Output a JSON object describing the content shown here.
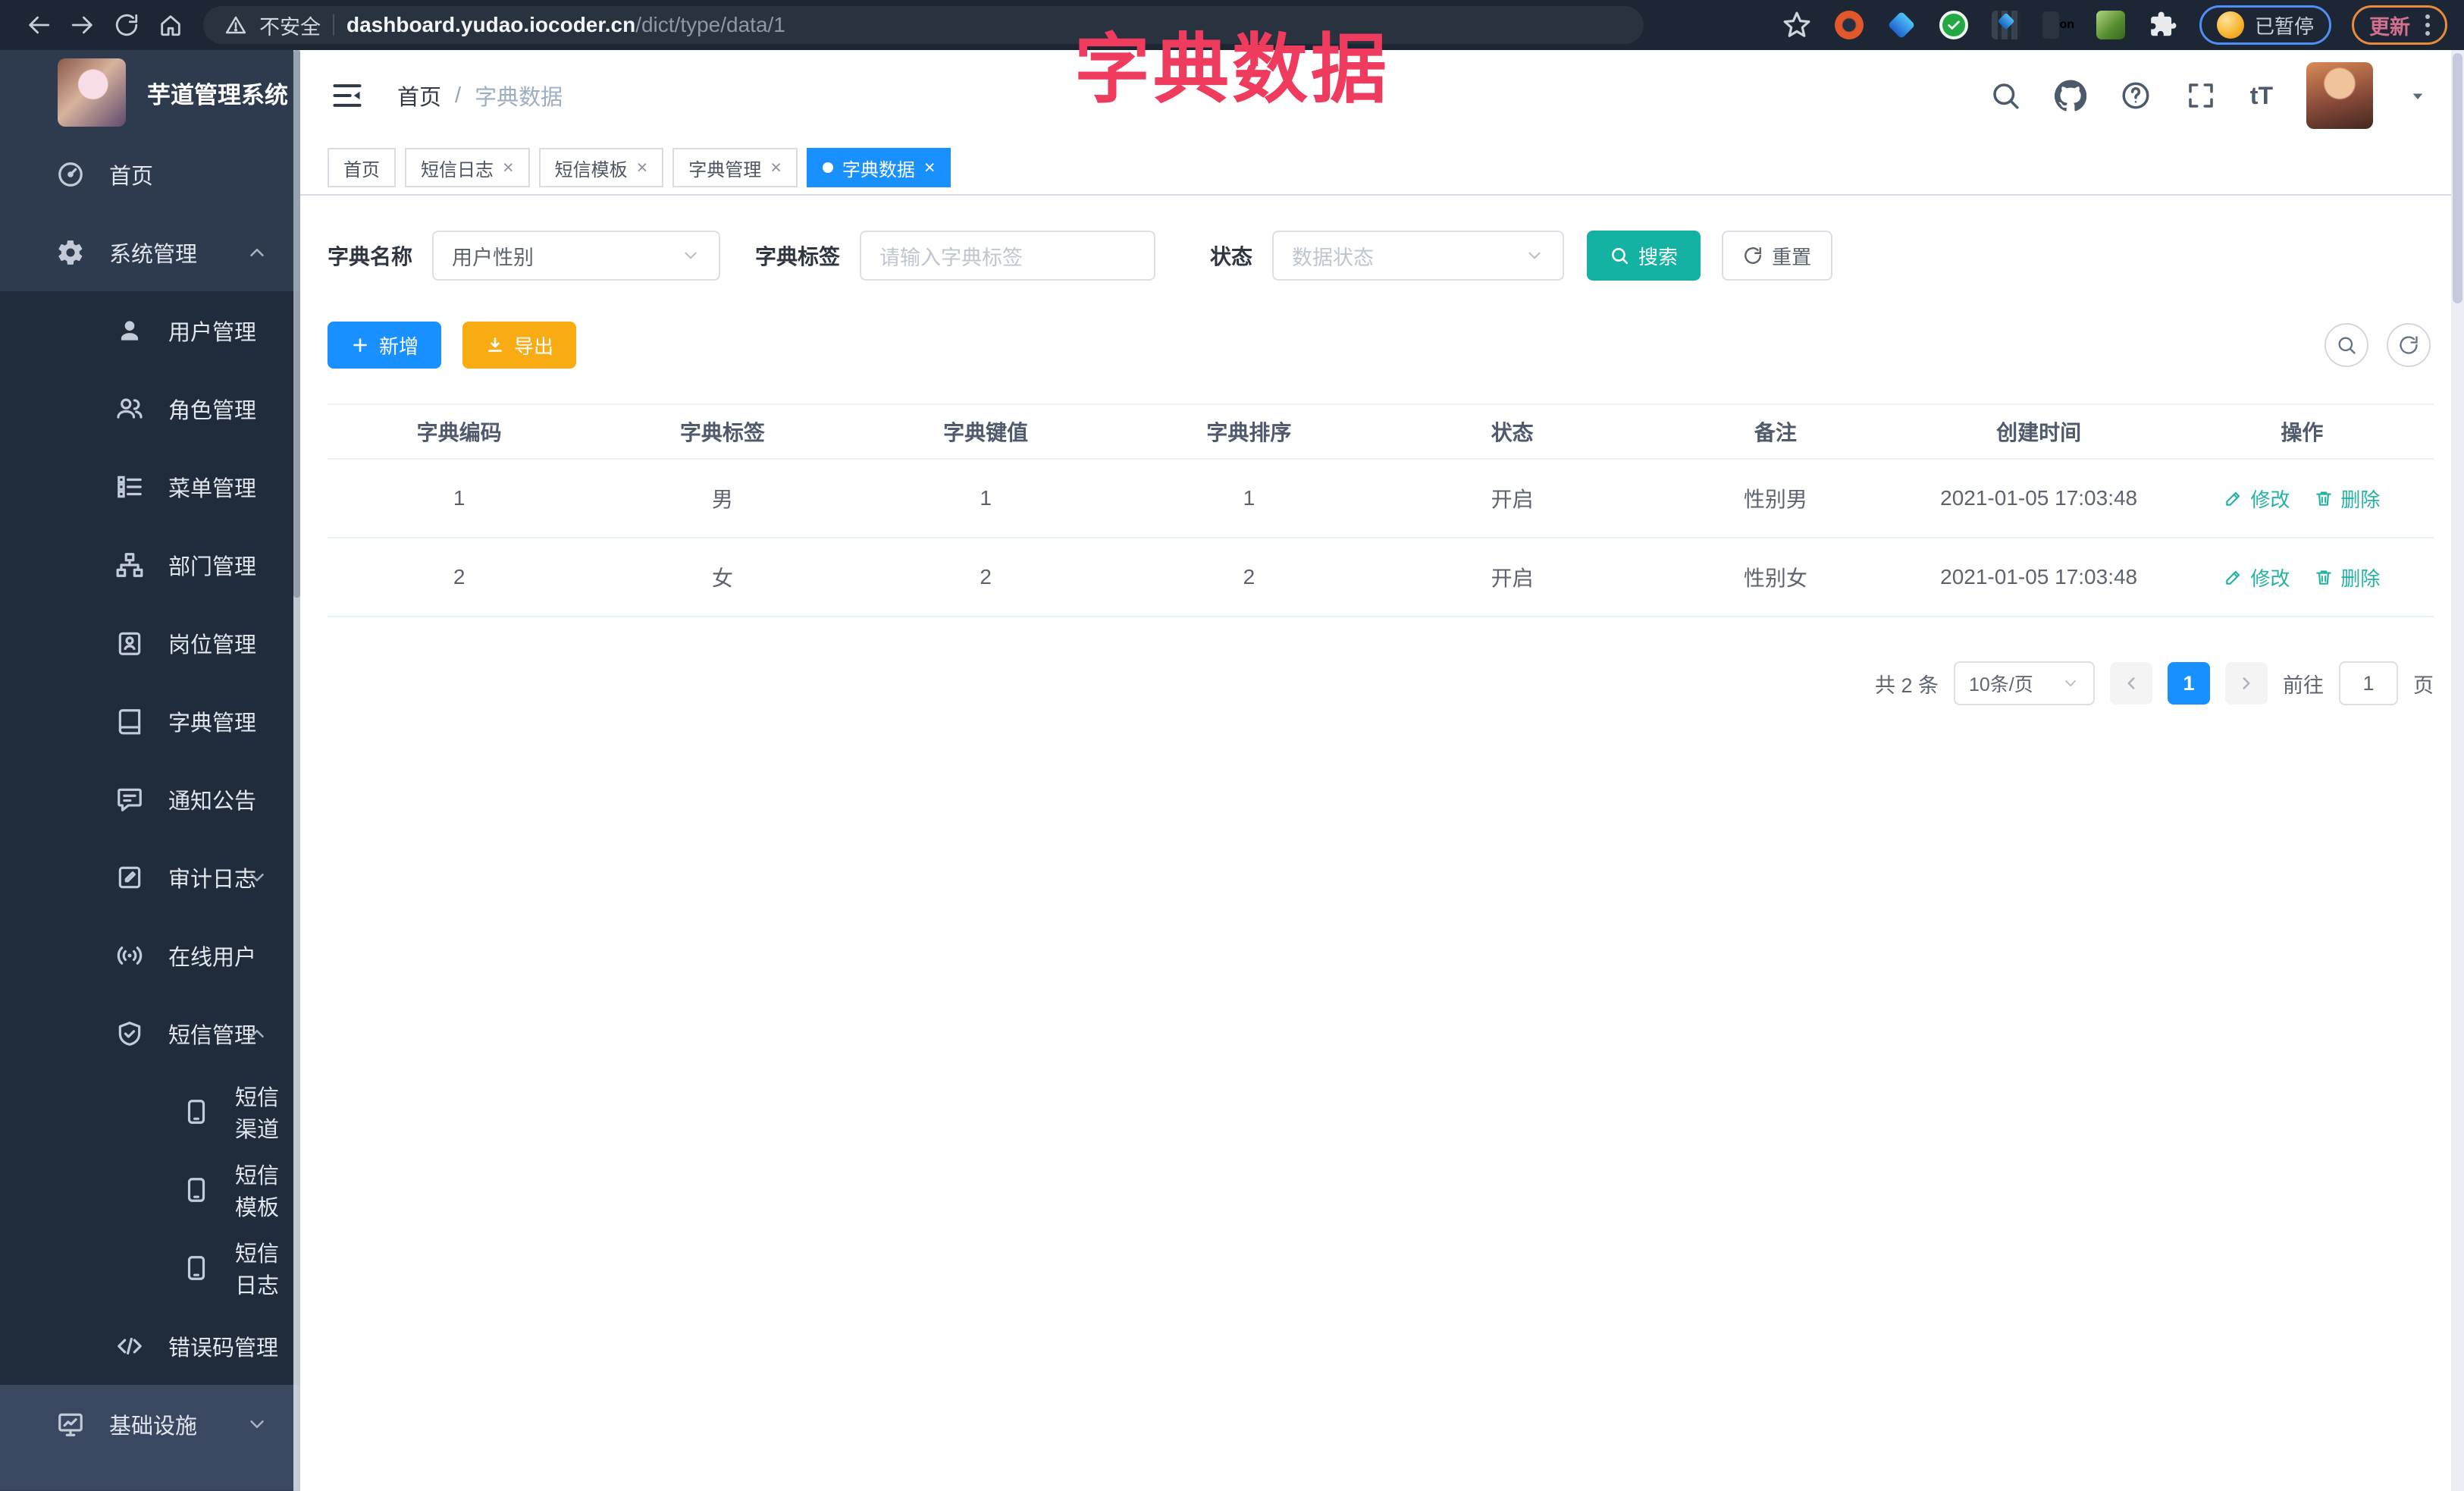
{
  "browser": {
    "security_label": "不安全",
    "url_domain": "dashboard.yudao.iocoder.cn",
    "url_path": "/dict/type/data/1",
    "paused_label": "已暂停",
    "update_label": "更新"
  },
  "overlay_title": "字典数据",
  "sidebar": {
    "logo_title": "芋道管理系统",
    "items": [
      {
        "label": "首页"
      },
      {
        "label": "系统管理"
      },
      {
        "label": "用户管理"
      },
      {
        "label": "角色管理"
      },
      {
        "label": "菜单管理"
      },
      {
        "label": "部门管理"
      },
      {
        "label": "岗位管理"
      },
      {
        "label": "字典管理"
      },
      {
        "label": "通知公告"
      },
      {
        "label": "审计日志"
      },
      {
        "label": "在线用户"
      },
      {
        "label": "短信管理"
      },
      {
        "label": "短信渠道"
      },
      {
        "label": "短信模板"
      },
      {
        "label": "短信日志"
      },
      {
        "label": "错误码管理"
      },
      {
        "label": "基础设施"
      }
    ]
  },
  "header": {
    "breadcrumb_home": "首页",
    "breadcrumb_sep": "/",
    "breadcrumb_current": "字典数据",
    "font_size_label": "tT"
  },
  "misc": {
    "close_glyph": "×"
  },
  "tabs": [
    {
      "label": "首页"
    },
    {
      "label": "短信日志"
    },
    {
      "label": "短信模板"
    },
    {
      "label": "字典管理"
    },
    {
      "label": "字典数据"
    }
  ],
  "filters": {
    "name_label": "字典名称",
    "name_value": "用户性别",
    "tag_label": "字典标签",
    "tag_placeholder": "请输入字典标签",
    "status_label": "状态",
    "status_placeholder": "数据状态",
    "search_label": "搜索",
    "reset_label": "重置"
  },
  "toolbar": {
    "add_label": "新增",
    "export_label": "导出"
  },
  "table": {
    "headers": [
      "字典编码",
      "字典标签",
      "字典键值",
      "字典排序",
      "状态",
      "备注",
      "创建时间",
      "操作"
    ],
    "rows": [
      {
        "code": "1",
        "label": "男",
        "value": "1",
        "sort": "1",
        "status": "开启",
        "remark": "性别男",
        "created": "2021-01-05 17:03:48"
      },
      {
        "code": "2",
        "label": "女",
        "value": "2",
        "sort": "2",
        "status": "开启",
        "remark": "性别女",
        "created": "2021-01-05 17:03:48"
      }
    ],
    "edit_label": "修改",
    "delete_label": "删除"
  },
  "pagination": {
    "total": "共 2 条",
    "page_size": "10条/页",
    "current_page": "1",
    "goto_label": "前往",
    "goto_value": "1",
    "unit_label": "页"
  },
  "colors": {
    "primary": "#1890ff",
    "teal": "#14b2a2",
    "warning": "#f9ab14",
    "annotation": "#ee3b5e",
    "sidebar_bg": "#2e3a4e",
    "submenu_bg": "#202c3c"
  }
}
